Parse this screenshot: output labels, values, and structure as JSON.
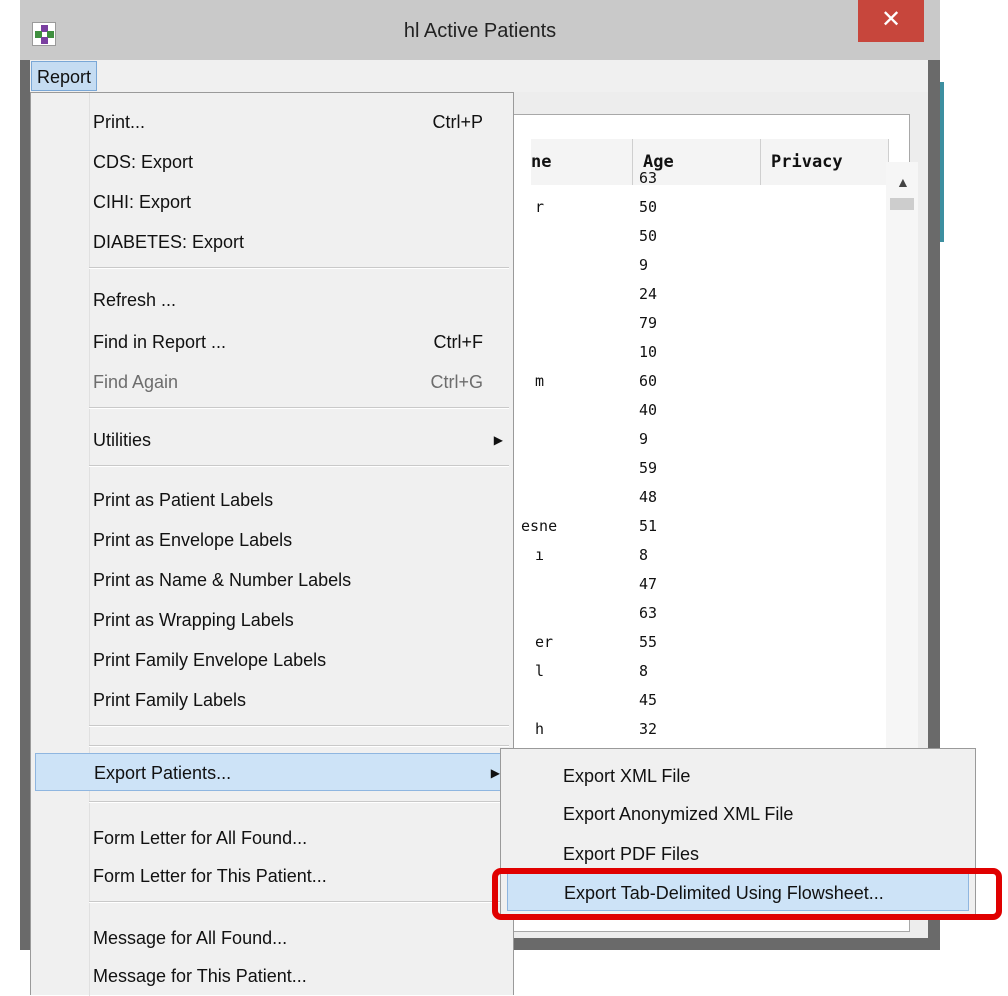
{
  "window": {
    "title": "hl Active Patients",
    "close_label": "✕",
    "menubar": {
      "report_label": "Report"
    }
  },
  "table": {
    "columns": [
      "ne",
      "Age",
      "Privacy"
    ],
    "name_fragments": [
      {
        "row": 1,
        "text": "r"
      },
      {
        "row": 7,
        "text": "m"
      },
      {
        "row": 12,
        "text": "esne"
      },
      {
        "row": 13,
        "text": "ı"
      },
      {
        "row": 16,
        "text": "er"
      },
      {
        "row": 17,
        "text": "l"
      },
      {
        "row": 19,
        "text": "h"
      }
    ],
    "ages": [
      "63",
      "50",
      "50",
      "9",
      "24",
      "79",
      "10",
      "60",
      "40",
      "9",
      "59",
      "48",
      "51",
      "8",
      "47",
      "63",
      "55",
      "8",
      "45",
      "32"
    ],
    "scroll_up_icon": "▲"
  },
  "report_menu": {
    "items": [
      {
        "label": "Print...",
        "shortcut": "Ctrl+P"
      },
      {
        "label": "CDS: Export"
      },
      {
        "label": "CIHI: Export"
      },
      {
        "label": "DIABETES: Export"
      },
      {
        "label": "Refresh ..."
      },
      {
        "label": "Find in Report ...",
        "shortcut": "Ctrl+F"
      },
      {
        "label": "Find Again",
        "shortcut": "Ctrl+G",
        "disabled": true
      },
      {
        "label": "Utilities",
        "submenu": true
      },
      {
        "label": "Print as Patient Labels"
      },
      {
        "label": "Print as Envelope Labels"
      },
      {
        "label": "Print as Name & Number Labels"
      },
      {
        "label": "Print as Wrapping Labels"
      },
      {
        "label": "Print Family Envelope Labels"
      },
      {
        "label": "Print Family Labels"
      },
      {
        "label": "Export Patients...",
        "submenu": true,
        "selected": true
      },
      {
        "label": "Form Letter for All Found..."
      },
      {
        "label": "Form Letter for This Patient..."
      },
      {
        "label": "Message for All Found..."
      },
      {
        "label": "Message for This Patient..."
      }
    ],
    "arrow_icon": "▶"
  },
  "export_submenu": {
    "items": [
      {
        "label": "Export XML File"
      },
      {
        "label": "Export Anonymized XML File"
      },
      {
        "label": "Export PDF Files"
      },
      {
        "label": "Export Tab-Delimited Using Flowsheet...",
        "selected": true
      }
    ]
  },
  "colors": {
    "selection": "#cde3f7",
    "close_button": "#c7463c",
    "highlight_ring": "#e00000"
  }
}
